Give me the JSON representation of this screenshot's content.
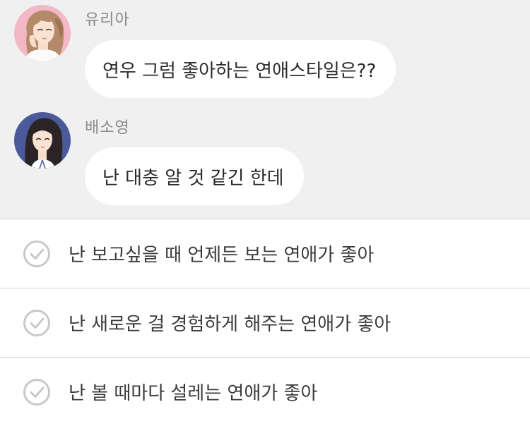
{
  "messages": [
    {
      "sender": "유리아",
      "text": "연우 그럼 좋아하는 연애스타일은??",
      "avatar_icon": "avatar-yuria-icon"
    },
    {
      "sender": "배소영",
      "text": "난 대충 알 것 같긴 한데",
      "avatar_icon": "avatar-baesoyoung-icon"
    }
  ],
  "options": [
    {
      "label": "난 보고싶을 때 언제든 보는 연애가 좋아",
      "icon": "checkmark-circle-icon"
    },
    {
      "label": "난 새로운 걸 경험하게 해주는 연애가 좋아",
      "icon": "checkmark-circle-icon"
    },
    {
      "label": "난 볼 때마다 설레는 연애가 좋아",
      "icon": "checkmark-circle-icon"
    }
  ],
  "colors": {
    "chat_background": "#f0f0f0",
    "bubble_background": "#ffffff",
    "sender_text": "#8a8a8a",
    "message_text": "#2b2b2b",
    "option_text": "#3a3a3a",
    "divider": "#d6d6d6",
    "check_icon": "#c8c8c8",
    "avatar1_background": "#f2b8c6",
    "avatar2_background": "#4a5a9a"
  }
}
